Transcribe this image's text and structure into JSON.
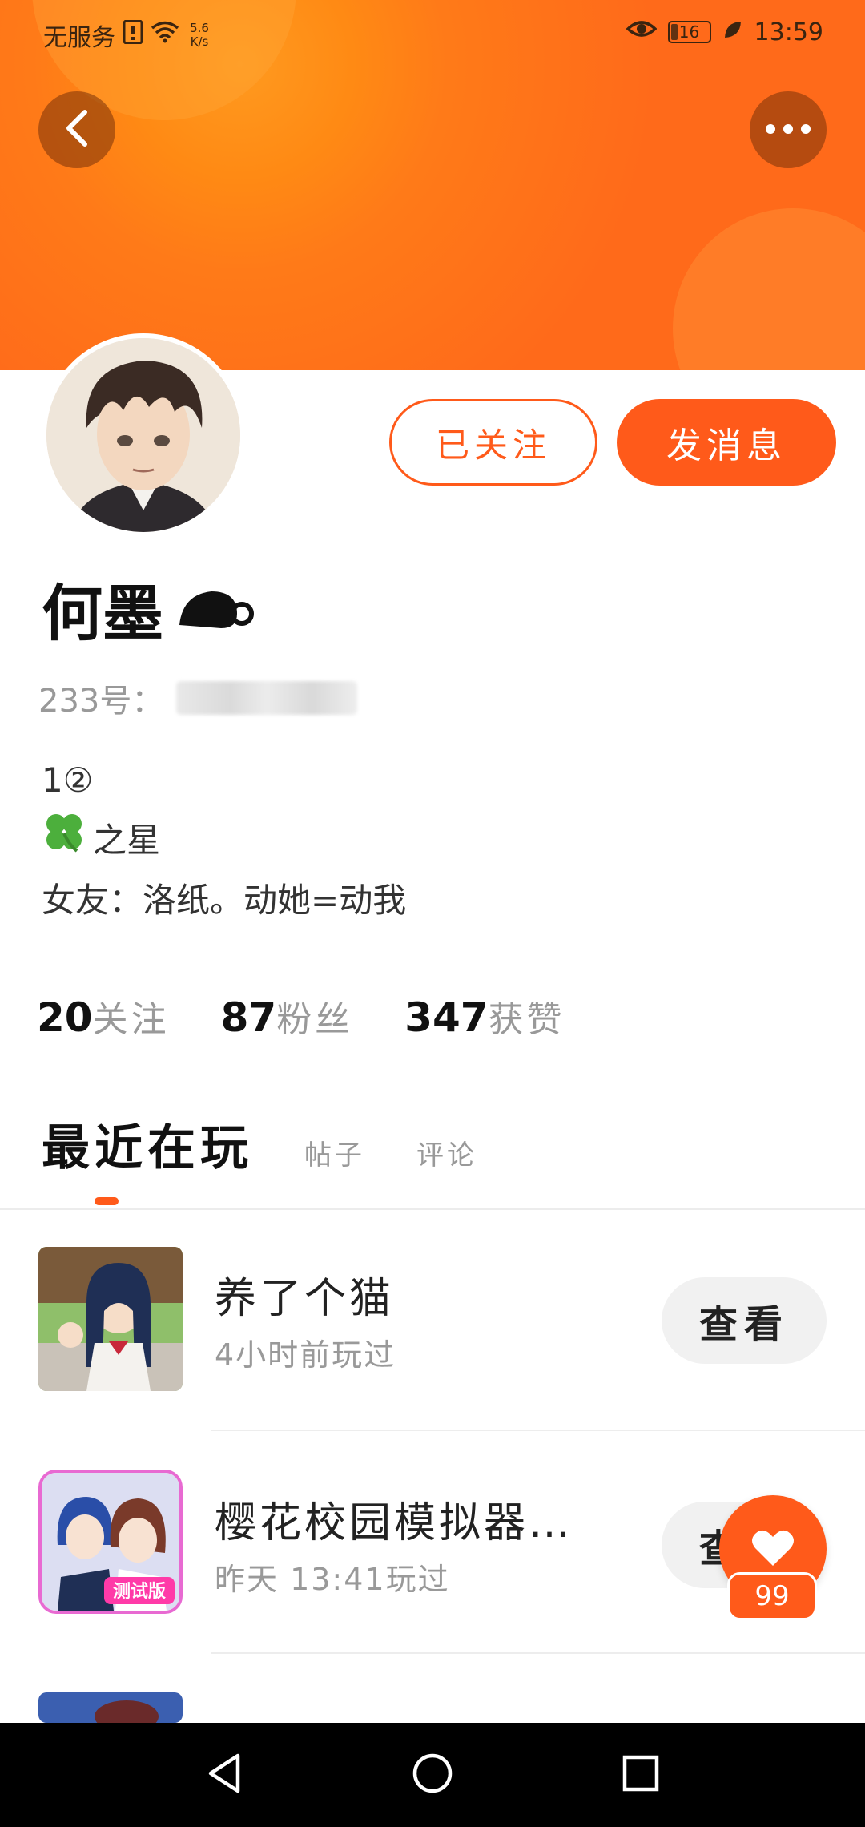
{
  "status_bar": {
    "carrier": "无服务",
    "net_speed_value": "5.6",
    "net_speed_unit": "K/s",
    "battery_level": "16",
    "time": "13:59"
  },
  "profile": {
    "name": "何墨",
    "id_label": "233号：",
    "follow_button": "已关注",
    "message_button": "发消息",
    "bio_lines": [
      "1②",
      "之星",
      "女友：洛纸。动她=动我"
    ],
    "stats": [
      {
        "value": "20",
        "label": "关注"
      },
      {
        "value": "87",
        "label": "粉丝"
      },
      {
        "value": "347",
        "label": "获赞"
      }
    ]
  },
  "tabs": [
    {
      "label": "最近在玩",
      "active": true
    },
    {
      "label": "帖子",
      "active": false
    },
    {
      "label": "评论",
      "active": false
    }
  ],
  "games": [
    {
      "title": "养了个猫",
      "time": "4小时前玩过",
      "action": "查看"
    },
    {
      "title": "樱花校园模拟器…",
      "time": "昨天 13:41玩过",
      "action": "查看",
      "icon_badge": "测试版"
    },
    {
      "title": "",
      "time": "",
      "action": ""
    }
  ],
  "like": {
    "count": "99"
  },
  "colors": {
    "accent": "#ff5a1a",
    "banner": "#ff7a18"
  },
  "icons": [
    "back-icon",
    "more-icon",
    "eye-icon",
    "wifi-icon",
    "alert-icon",
    "leaf-icon",
    "clover-icon",
    "heart-icon",
    "nav-back-icon",
    "nav-home-icon",
    "nav-recent-icon"
  ]
}
